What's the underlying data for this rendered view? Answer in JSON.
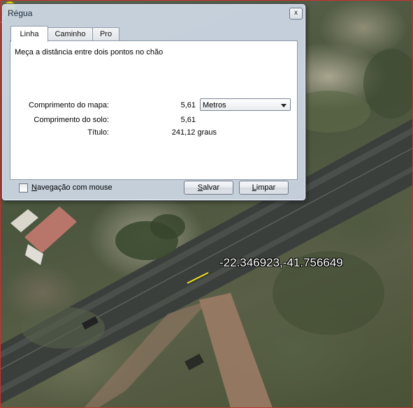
{
  "dialog": {
    "title": "Régua",
    "close_label": "x",
    "tabs": [
      {
        "label": "Linha",
        "active": true
      },
      {
        "label": "Caminho",
        "active": false
      },
      {
        "label": "Pro",
        "active": false
      }
    ],
    "description": "Meça a distância entre dois pontos no chão",
    "map_length": {
      "label": "Comprimento do mapa:",
      "value": "5,61"
    },
    "unit_select": {
      "selected": "Metros"
    },
    "ground_length": {
      "label": "Comprimento do solo:",
      "value": "5,61"
    },
    "heading": {
      "label": "Título:",
      "value": "241,12 graus"
    },
    "mouse_nav": {
      "label_first": "N",
      "label_rest": "avegação com mouse",
      "checked": false
    },
    "save_button": {
      "label_first": "S",
      "label_rest": "alvar"
    },
    "clear_button": {
      "label_first": "L",
      "label_rest": "impar"
    }
  },
  "map": {
    "coordinate_label": "-22.346923,-41.756649",
    "pin_color": "#f2e21a",
    "border_color": "#c83030"
  }
}
